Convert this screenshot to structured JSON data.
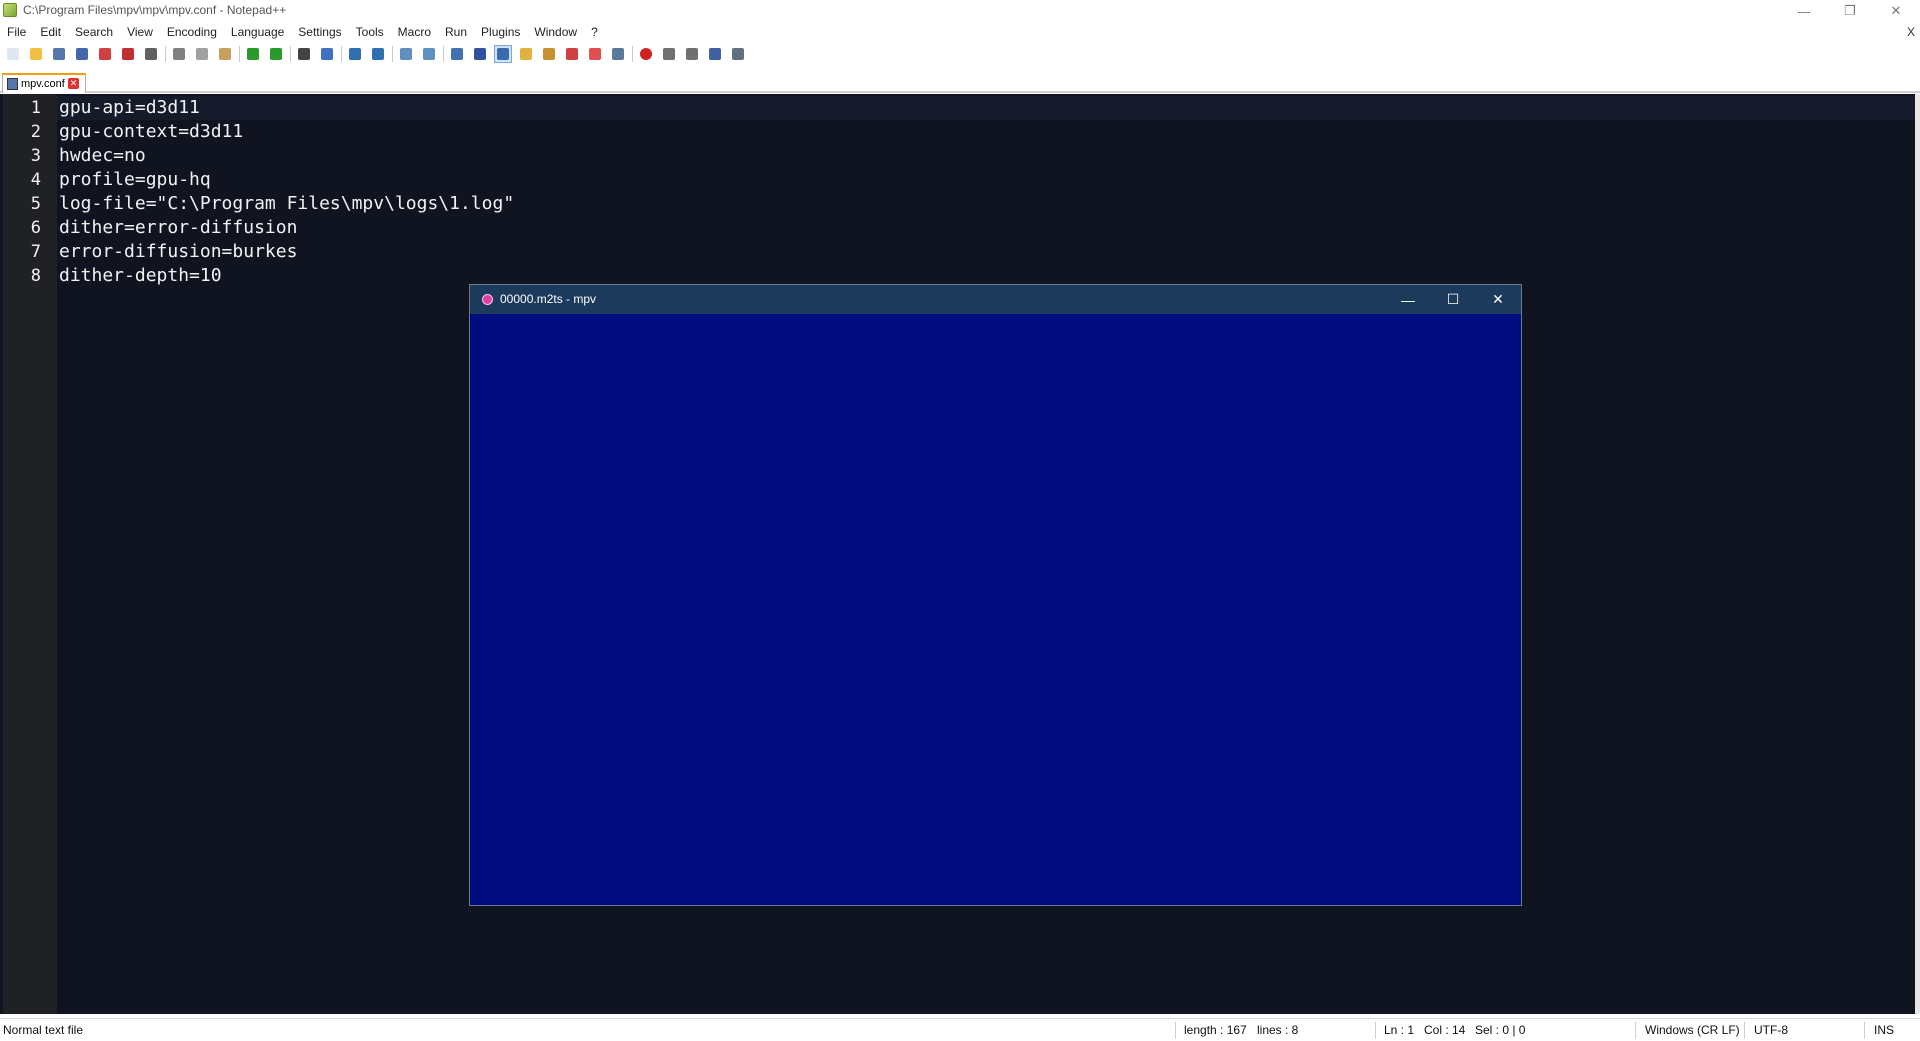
{
  "window": {
    "title": "C:\\Program Files\\mpv\\mpv\\mpv.conf - Notepad++",
    "minimize_glyph": "—",
    "maximize_glyph": "❐",
    "close_glyph": "✕"
  },
  "menu": {
    "items": [
      "File",
      "Edit",
      "Search",
      "View",
      "Encoding",
      "Language",
      "Settings",
      "Tools",
      "Macro",
      "Run",
      "Plugins",
      "Window",
      "?"
    ],
    "close_doc_glyph": "X"
  },
  "toolbar": {
    "icons": [
      "new-file-icon",
      "open-file-icon",
      "save-icon",
      "save-all-icon",
      "close-icon",
      "close-all-icon",
      "print-icon",
      "|",
      "cut-icon",
      "copy-icon",
      "paste-icon",
      "|",
      "undo-icon",
      "redo-icon",
      "|",
      "find-icon",
      "replace-icon",
      "|",
      "zoom-in-icon",
      "zoom-out-icon",
      "|",
      "sync-vertical-icon",
      "sync-horizontal-icon",
      "|",
      "word-wrap-icon",
      "show-all-characters-icon",
      "indent-guide-icon",
      "user-language-icon",
      "document-map-icon",
      "function-list-icon",
      "folder-workspace-icon",
      "monitoring-icon",
      "|",
      "record-macro-icon",
      "stop-macro-icon",
      "play-macro-icon",
      "run-macro-multiple-icon",
      "save-macro-icon"
    ],
    "active_icon": "indent-guide-icon"
  },
  "tabs": [
    {
      "label": "mpv.conf",
      "close_glyph": "✕"
    }
  ],
  "editor": {
    "lines": [
      "gpu-api=d3d11",
      "gpu-context=d3d11",
      "hwdec=no",
      "profile=gpu-hq",
      "log-file=\"C:\\Program Files\\mpv\\logs\\1.log\"",
      "dither=error-diffusion",
      "error-diffusion=burkes",
      "dither-depth=10"
    ],
    "line_numbers": [
      "1",
      "2",
      "3",
      "4",
      "5",
      "6",
      "7",
      "8"
    ],
    "background": "#101421",
    "text_color": "#f2f2f2"
  },
  "mpv": {
    "title": "00000.m2ts - mpv",
    "minimize_glyph": "—",
    "maximize_glyph": "☐",
    "close_glyph": "✕",
    "video_color": "#000d80"
  },
  "statusbar": {
    "file_type": "Normal text file",
    "length": "length : 167",
    "lines": "lines : 8",
    "ln": "Ln : 1",
    "col": "Col : 14",
    "sel": "Sel : 0 | 0",
    "eol": "Windows (CR LF)",
    "encoding": "UTF-8",
    "mode": "INS"
  }
}
